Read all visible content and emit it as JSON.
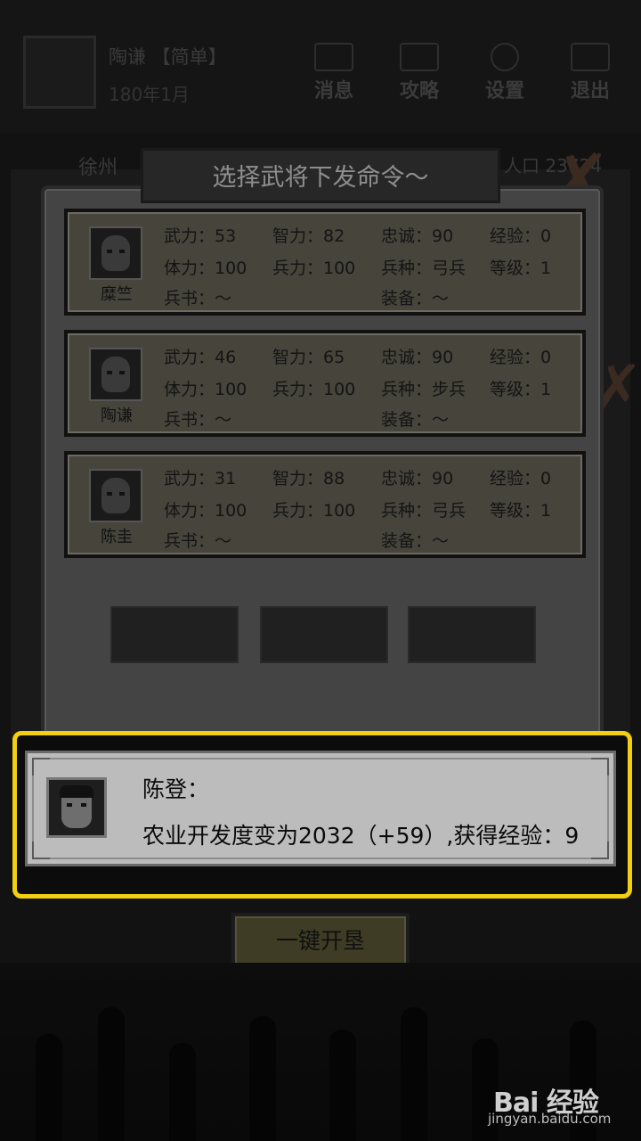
{
  "header": {
    "ruler_name": "陶谦 【简单】",
    "date": "180年1月",
    "buttons": [
      {
        "label": "消息",
        "icon": "scroll-icon"
      },
      {
        "label": "攻略",
        "icon": "book-icon"
      },
      {
        "label": "设置",
        "icon": "gear-icon"
      },
      {
        "label": "退出",
        "icon": "exit-icon"
      }
    ]
  },
  "city_bar": {
    "city": "徐州",
    "population": "人口 23724"
  },
  "dialog": {
    "title": "选择武将下发命令～",
    "generals": [
      {
        "name": "糜竺",
        "wuli": "武力：53",
        "zhili": "智力：82",
        "zhongcheng": "忠诚：90",
        "jingyan": "经验：0",
        "tili": "体力：100",
        "bingli": "兵力：100",
        "bingzhong": "兵种：弓兵",
        "dengji": "等级：1",
        "bingshu": "兵书：～",
        "zhuangbei": "装备：～"
      },
      {
        "name": "陶谦",
        "wuli": "武力：46",
        "zhili": "智力：65",
        "zhongcheng": "忠诚：90",
        "jingyan": "经验：0",
        "tili": "体力：100",
        "bingli": "兵力：100",
        "bingzhong": "兵种：步兵",
        "dengji": "等级：1",
        "bingshu": "兵书：～",
        "zhuangbei": "装备：～"
      },
      {
        "name": "陈圭",
        "wuli": "武力：31",
        "zhili": "智力：88",
        "zhongcheng": "忠诚：90",
        "jingyan": "经验：0",
        "tili": "体力：100",
        "bingli": "兵力：100",
        "bingzhong": "兵种：弓兵",
        "dengji": "等级：1",
        "bingshu": "兵书：～",
        "zhuangbei": "装备：～"
      }
    ]
  },
  "notice": {
    "speaker": "陈登：",
    "message": "农业开发度变为2032（+59）,获得经验：9"
  },
  "action_button": {
    "label": "一键开垦"
  },
  "watermark": {
    "logo": "Bai 经验",
    "url": "jingyan.baidu.com"
  },
  "colors": {
    "highlight": "#f2cf10",
    "card": "#46443b",
    "notice": "#bcbcbc",
    "button": "#3e3c24"
  }
}
